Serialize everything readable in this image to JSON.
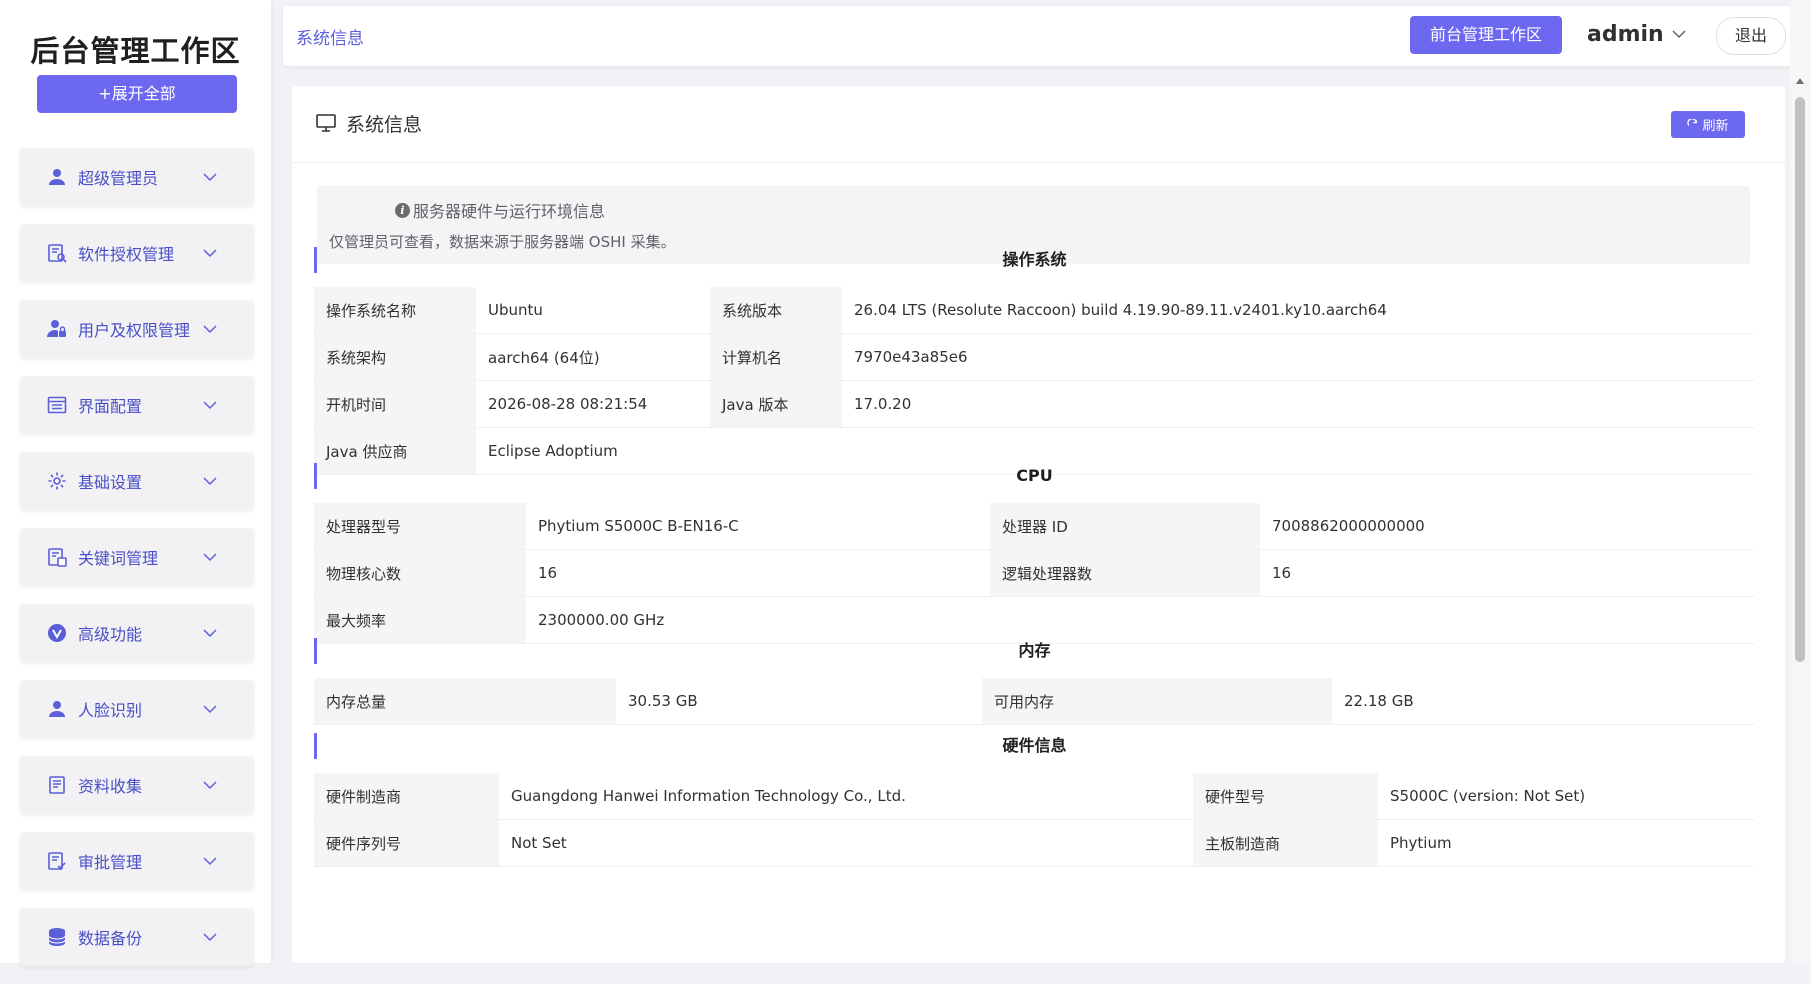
{
  "sidebar": {
    "brand": "后台管理工作区",
    "expand_label": "+展开全部",
    "items": [
      {
        "label": "超级管理员",
        "icon": "user-icon"
      },
      {
        "label": "软件授权管理",
        "icon": "license-icon"
      },
      {
        "label": "用户及权限管理",
        "icon": "user-lock-icon"
      },
      {
        "label": "界面配置",
        "icon": "layout-icon"
      },
      {
        "label": "基础设置",
        "icon": "gear-icon"
      },
      {
        "label": "关键词管理",
        "icon": "keyword-icon"
      },
      {
        "label": "高级功能",
        "icon": "check-badge-icon"
      },
      {
        "label": "人脸识别",
        "icon": "face-user-icon"
      },
      {
        "label": "资料收集",
        "icon": "document-icon"
      },
      {
        "label": "审批管理",
        "icon": "approval-icon"
      },
      {
        "label": "数据备份",
        "icon": "database-icon"
      }
    ]
  },
  "header": {
    "breadcrumb": "系统信息",
    "front_button": "前台管理工作区",
    "username": "admin",
    "logout": "退出"
  },
  "card": {
    "title": "系统信息",
    "refresh_label": "刷新",
    "notice_title": "服务器硬件与运行环境信息",
    "notice_desc": "仅管理员可查看，数据来源于服务器端 OSHI 采集。"
  },
  "sections": {
    "os": {
      "title": "操作系统",
      "rows": [
        [
          "操作系统名称",
          "Ubuntu",
          "系统版本",
          "26.04 LTS (Resolute Raccoon) build 4.19.90-89.11.v2401.ky10.aarch64"
        ],
        [
          "系统架构",
          "aarch64 (64位)",
          "计算机名",
          "7970e43a85e6"
        ],
        [
          "开机时间",
          "2026-08-28 08:21:54",
          "Java 版本",
          "17.0.20"
        ],
        [
          "Java 供应商",
          "Eclipse Adoptium",
          "",
          ""
        ]
      ]
    },
    "cpu": {
      "title": "CPU",
      "rows": [
        [
          "处理器型号",
          "Phytium S5000C B-EN16-C",
          "处理器 ID",
          "7008862000000000"
        ],
        [
          "物理核心数",
          "16",
          "逻辑处理器数",
          "16"
        ],
        [
          "最大频率",
          "2300000.00 GHz",
          "",
          ""
        ]
      ]
    },
    "memory": {
      "title": "内存",
      "rows": [
        [
          "内存总量",
          "30.53 GB",
          "可用内存",
          "22.18 GB"
        ]
      ]
    },
    "hardware": {
      "title": "硬件信息",
      "rows": [
        [
          "硬件制造商",
          "Guangdong Hanwei Information Technology Co., Ltd.",
          "硬件型号",
          "S5000C (version: Not Set)"
        ],
        [
          "硬件序列号",
          "Not Set",
          "主板制造商",
          "Phytium"
        ]
      ]
    }
  },
  "colors": {
    "accent": "#6d68f0",
    "menu_text": "#4a4fc6",
    "label_bg": "#f4f5f7"
  }
}
